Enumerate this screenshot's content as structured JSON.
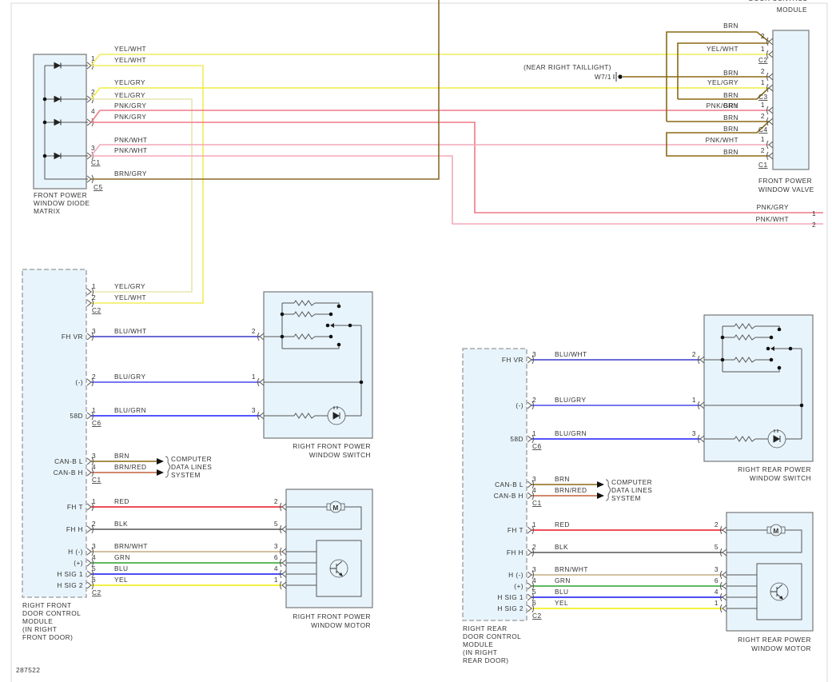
{
  "figure_id": "287522",
  "top_module": {
    "name_lines": [
      "DOOR CONTROL",
      "MODULE"
    ]
  },
  "diode_matrix": {
    "name_lines": [
      "FRONT POWER",
      "WINDOW DIODE",
      "MATRIX"
    ],
    "connector_c1": "C1",
    "connector_c5": "C5",
    "pins": [
      "1",
      "2",
      "4",
      "3"
    ]
  },
  "top_wires": [
    {
      "code": "YEL/WHT",
      "color": "#f0ec5a"
    },
    {
      "code": "YEL/WHT",
      "color": "#f0ec5a"
    },
    {
      "code": "YEL/GRY",
      "color": "#f0ee40"
    },
    {
      "code": "YEL/GRY",
      "color": "#e8e6b0"
    },
    {
      "code": "PNK/GRY",
      "color": "#f07888"
    },
    {
      "code": "PNK/GRY",
      "color": "#f07888"
    },
    {
      "code": "PNK/WHT",
      "color": "#f4a8b8"
    },
    {
      "code": "PNK/WHT",
      "color": "#f4a8b8"
    },
    {
      "code": "BRN/GRY",
      "color": "#8a6a2a"
    }
  ],
  "exit_pins": [
    "1",
    "2"
  ],
  "ground": {
    "location": "(NEAR RIGHT TAILLIGHT)",
    "id": "W7/1"
  },
  "valve": {
    "name_lines": [
      "FRONT POWER",
      "WINDOW VALVE"
    ],
    "connectors": [
      "C2",
      "C3",
      "C4",
      "C1"
    ],
    "pins": [
      "2",
      "1",
      "2",
      "1",
      "1",
      "2",
      "1",
      "2"
    ],
    "brn_labels": [
      "BRN",
      "BRN",
      "BRN",
      "BRN",
      "BRN",
      "BRN",
      "BRN"
    ],
    "brn_color": "#8b6914"
  },
  "doors": [
    {
      "name_lines": [
        "RIGHT FRONT",
        "DOOR CONTROL",
        "MODULE",
        "(IN RIGHT",
        "FRONT DOOR)"
      ],
      "switch_name": [
        "RIGHT FRONT POWER",
        "WINDOW SWITCH"
      ],
      "motor_name": [
        "RIGHT FRONT POWER",
        "WINDOW MOTOR"
      ],
      "top_connector": {
        "id": "C2",
        "pins": [
          {
            "pin": "1",
            "code": "YEL/GRY"
          },
          {
            "pin": "2",
            "code": "YEL/WHT"
          }
        ]
      },
      "switch_connector": "C6",
      "switch_circuits": [
        {
          "term": "FH VR",
          "pin": "3",
          "code": "BLU/WHT",
          "color": "#3a3ac8",
          "dest_pin": "2"
        },
        {
          "term": "(-)",
          "pin": "2",
          "code": "BLU/GRY",
          "color": "#4848e8",
          "dest_pin": "1"
        },
        {
          "term": "58D",
          "pin": "1",
          "code": "BLU/GRN",
          "color": "#1c1cff",
          "dest_pin": "3"
        }
      ],
      "can_connector": "C1",
      "can_circuits": [
        {
          "term": "CAN-B L",
          "pin": "3",
          "code": "BRN",
          "color": "#8b6914"
        },
        {
          "term": "CAN-B H",
          "pin": "4",
          "code": "BRN/RED",
          "color": "#c0603a"
        }
      ],
      "can_dest": [
        "COMPUTER",
        "DATA LINES",
        "SYSTEM"
      ],
      "motor_connector": "C2",
      "motor_circuits": [
        {
          "term": "FH T",
          "pin": "1",
          "code": "RED",
          "color": "#e81420",
          "dest_pin": "2"
        },
        {
          "term": "FH H",
          "pin": "2",
          "code": "BLK",
          "color": "#555555",
          "dest_pin": "5"
        },
        {
          "term": "H (-)",
          "pin": "3",
          "code": "BRN/WHT",
          "color": "#c4ac80",
          "dest_pin": "3"
        },
        {
          "term": "(+)",
          "pin": "4",
          "code": "GRN",
          "color": "#2ca02c",
          "dest_pin": "6"
        },
        {
          "term": "H SIG 1",
          "pin": "5",
          "code": "BLU",
          "color": "#1010ee",
          "dest_pin": "4"
        },
        {
          "term": "H SIG 2",
          "pin": "6",
          "code": "YEL",
          "color": "#f4ee00",
          "dest_pin": "1"
        }
      ]
    },
    {
      "name_lines": [
        "RIGHT REAR",
        "DOOR CONTROL",
        "MODULE",
        "(IN RIGHT",
        "REAR DOOR)"
      ],
      "switch_name": [
        "RIGHT REAR POWER",
        "WINDOW SWITCH"
      ],
      "motor_name": [
        "RIGHT REAR POWER",
        "WINDOW MOTOR"
      ],
      "switch_connector": "C6",
      "switch_circuits": [
        {
          "term": "FH VR",
          "pin": "3",
          "code": "BLU/WHT",
          "color": "#3a3ac8",
          "dest_pin": "2"
        },
        {
          "term": "(-)",
          "pin": "2",
          "code": "BLU/GRY",
          "color": "#4848e8",
          "dest_pin": "1"
        },
        {
          "term": "58D",
          "pin": "1",
          "code": "BLU/GRN",
          "color": "#1c1cff",
          "dest_pin": "3"
        }
      ],
      "can_connector": "C1",
      "can_circuits": [
        {
          "term": "CAN-B L",
          "pin": "3",
          "code": "BRN",
          "color": "#8b6914"
        },
        {
          "term": "CAN-B H",
          "pin": "4",
          "code": "BRN/RED",
          "color": "#c0603a"
        }
      ],
      "can_dest": [
        "COMPUTER",
        "DATA LINES",
        "SYSTEM"
      ],
      "motor_connector": "C2",
      "motor_circuits": [
        {
          "term": "FH T",
          "pin": "1",
          "code": "RED",
          "color": "#e81420",
          "dest_pin": "2"
        },
        {
          "term": "FH H",
          "pin": "2",
          "code": "BLK",
          "color": "#555555",
          "dest_pin": "5"
        },
        {
          "term": "H (-)",
          "pin": "3",
          "code": "BRN/WHT",
          "color": "#c4ac80",
          "dest_pin": "3"
        },
        {
          "term": "(+)",
          "pin": "4",
          "code": "GRN",
          "color": "#2ca02c",
          "dest_pin": "6"
        },
        {
          "term": "H SIG 1",
          "pin": "5",
          "code": "BLU",
          "color": "#1010ee",
          "dest_pin": "4"
        },
        {
          "term": "H SIG 2",
          "pin": "6",
          "code": "YEL",
          "color": "#f4ee00",
          "dest_pin": "1"
        }
      ]
    }
  ]
}
